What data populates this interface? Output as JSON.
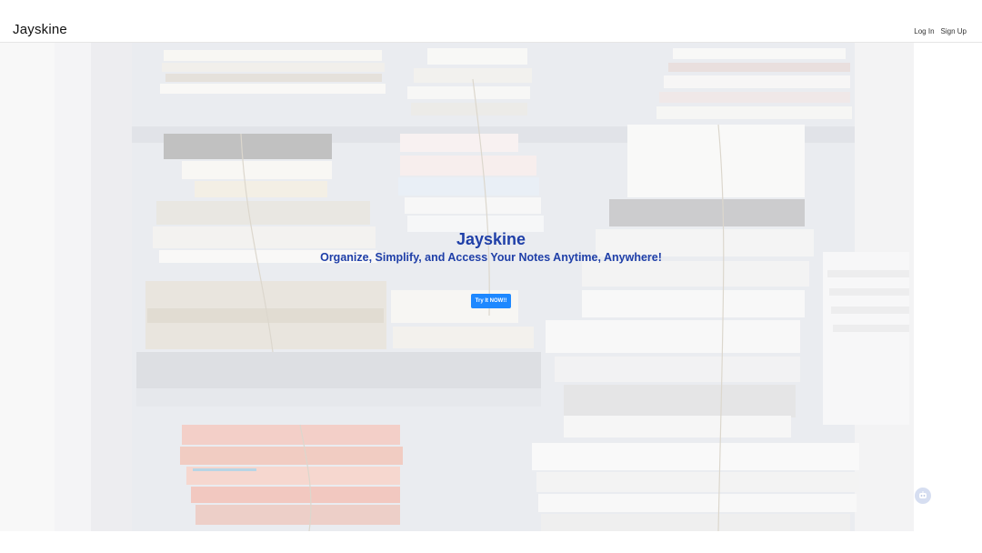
{
  "nav": {
    "brand": "Jayskine",
    "login": "Log In",
    "signup": "Sign Up"
  },
  "hero": {
    "title": "Jayskine",
    "subtitle": "Organize, Simplify, and Access Your Notes Anytime, Anywhere!",
    "cta_label": "Try It NOW!!",
    "background_image": "bookshelf-with-stacked-notebooks",
    "title_color": "#1f3fa8",
    "cta_color": "#1e88ff"
  },
  "widgets": {
    "chat_icon": "chat-bot-icon"
  }
}
